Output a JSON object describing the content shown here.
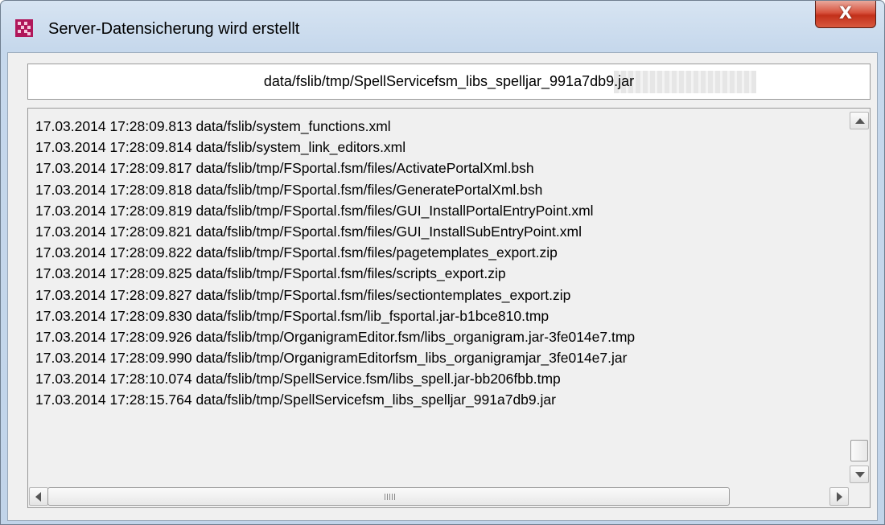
{
  "window": {
    "title": "Server-Datensicherung wird erstellt",
    "close_label": "X",
    "app_icon": "app-logo-icon",
    "close_color": "#c2301a"
  },
  "current_file": "data/fslib/tmp/SpellServicefsm_libs_spelljar_991a7db9.jar",
  "log": [
    "17.03.2014 17:28:09.813 data/fslib/system_functions.xml",
    "17.03.2014 17:28:09.814 data/fslib/system_link_editors.xml",
    "17.03.2014 17:28:09.817 data/fslib/tmp/FSportal.fsm/files/ActivatePortalXml.bsh",
    "17.03.2014 17:28:09.818 data/fslib/tmp/FSportal.fsm/files/GeneratePortalXml.bsh",
    "17.03.2014 17:28:09.819 data/fslib/tmp/FSportal.fsm/files/GUI_InstallPortalEntryPoint.xml",
    "17.03.2014 17:28:09.821 data/fslib/tmp/FSportal.fsm/files/GUI_InstallSubEntryPoint.xml",
    "17.03.2014 17:28:09.822 data/fslib/tmp/FSportal.fsm/files/pagetemplates_export.zip",
    "17.03.2014 17:28:09.825 data/fslib/tmp/FSportal.fsm/files/scripts_export.zip",
    "17.03.2014 17:28:09.827 data/fslib/tmp/FSportal.fsm/files/sectiontemplates_export.zip",
    "17.03.2014 17:28:09.830 data/fslib/tmp/FSportal.fsm/lib_fsportal.jar-b1bce810.tmp",
    "17.03.2014 17:28:09.926 data/fslib/tmp/OrganigramEditor.fsm/libs_organigram.jar-3fe014e7.tmp",
    "17.03.2014 17:28:09.990 data/fslib/tmp/OrganigramEditorfsm_libs_organigramjar_3fe014e7.jar",
    "17.03.2014 17:28:10.074 data/fslib/tmp/SpellService.fsm/libs_spell.jar-bb206fbb.tmp",
    "17.03.2014 17:28:15.764 data/fslib/tmp/SpellServicefsm_libs_spelljar_991a7db9.jar"
  ],
  "icons": {
    "scroll_up": "chevron-up-icon",
    "scroll_down": "chevron-down-icon",
    "scroll_left": "chevron-left-icon",
    "scroll_right": "chevron-right-icon"
  }
}
